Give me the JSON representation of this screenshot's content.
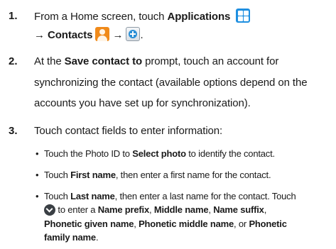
{
  "steps": [
    {
      "number": "1.",
      "lines": [
        {
          "a": "From a Home screen, touch ",
          "b": "Applications"
        },
        {
          "arrow1": "→ ",
          "b": "Contacts",
          "arrow2": " → ",
          "end": "."
        }
      ]
    },
    {
      "number": "2.",
      "lines": [
        {
          "a": "At the ",
          "b": "Save contact to",
          "c": " prompt, touch an account for"
        },
        {
          "a": "synchronizing the contact (available options depend on the"
        },
        {
          "a": "accounts you have set up for synchronization)."
        }
      ]
    },
    {
      "number": "3.",
      "lines": [
        {
          "a": "Touch contact fields to enter information:"
        }
      ],
      "bullets": [
        {
          "a": "Touch the Photo ID to ",
          "b": "Select photo",
          "c": " to identify the contact."
        },
        {
          "a": "Touch ",
          "b": "First name",
          "c": ", then enter a first name for the contact."
        },
        {
          "a": "Touch ",
          "b": "Last name",
          "c": ", then enter a last name for the contact. Touch"
        }
      ],
      "continuation": {
        "line1": {
          "a": " to enter a ",
          "b1": "Name prefix",
          "s1": ", ",
          "b2": "Middle name",
          "s2": ", ",
          "b3": "Name suffix",
          "s3": ","
        },
        "line2": {
          "b1": "Phonetic given name",
          "s1": ", ",
          "b2": "Phonetic middle name",
          "s2": ", or ",
          "b3": "Phonetic"
        },
        "line3": {
          "b1": "family name",
          "s1": "."
        }
      }
    }
  ],
  "icons": {
    "applications": "applications-grid-icon",
    "contacts": "contacts-person-icon",
    "add": "add-contact-icon",
    "expand": "chevron-down-circle-icon"
  },
  "colors": {
    "applications_icon": "#1f8fe0",
    "contacts_icon": "#f08a1a",
    "add_icon": "#2b8fd6",
    "expand_icon": "#3a3f44"
  }
}
